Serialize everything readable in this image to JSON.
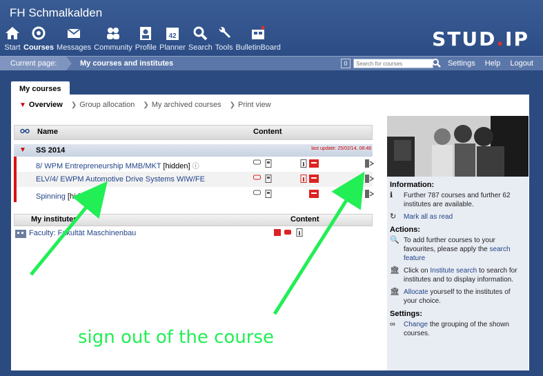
{
  "site_title": "FH Schmalkalden",
  "nav": [
    {
      "label": "Start",
      "icon": "home-icon"
    },
    {
      "label": "Courses",
      "icon": "courses-icon"
    },
    {
      "label": "Messages",
      "icon": "envelope-icon"
    },
    {
      "label": "Community",
      "icon": "people-icon"
    },
    {
      "label": "Profile",
      "icon": "profile-icon"
    },
    {
      "label": "Planner",
      "icon": "calendar-icon",
      "badge": "42"
    },
    {
      "label": "Search",
      "icon": "search-icon"
    },
    {
      "label": "Tools",
      "icon": "wrench-icon"
    },
    {
      "label": "BulletinBoard",
      "icon": "bulletin-icon"
    }
  ],
  "logo": {
    "part1": "STUD",
    "dot": ".",
    "part2": "IP"
  },
  "breadcrumb": {
    "label": "Current page:",
    "current": "My courses and institutes"
  },
  "counter": "0",
  "search_placeholder": "Search for courses",
  "toplinks": [
    "Settings",
    "Help",
    "Logout"
  ],
  "tab": "My courses",
  "subnav": [
    {
      "label": "Overview",
      "active": true
    },
    {
      "label": "Group allocation",
      "active": false
    },
    {
      "label": "My archived courses",
      "active": false
    },
    {
      "label": "Print view",
      "active": false
    }
  ],
  "table": {
    "col_name": "Name",
    "col_content": "Content"
  },
  "semester": {
    "name": "SS 2014",
    "last_update": "last update: 25/02/14, 08:48"
  },
  "courses": [
    {
      "title": "8/ WPM Entrepreneurship MMB/MKT",
      "suffix": "[hidden]"
    },
    {
      "title": "ELV/4/ EWPM Automotive Drive Systems WIW/FE",
      "suffix": ""
    },
    {
      "title": "Spinning",
      "suffix": "[hidden]"
    }
  ],
  "institutes": {
    "header": "My institutes",
    "content": "Content",
    "item": "Faculty: Fakultät Maschinenbau"
  },
  "sidebar": {
    "info_title": "Information:",
    "info_text": "Further 787 courses and further 62 institutes are available.",
    "mark_read": "Mark all as read",
    "actions_title": "Actions:",
    "action1_pre": "To add further courses to your favourites, please apply the",
    "action1_link": "search feature",
    "action2_pre": "Click on",
    "action2_link": "Institute search",
    "action2_post": "to search for institutes and to display information.",
    "action3_link": "Allocate",
    "action3_post": "yourself to the institutes of your choice.",
    "settings_title": "Settings:",
    "setting_link": "Change",
    "setting_post": "the grouping of the shown courses."
  },
  "annotation": "sign out of the course"
}
